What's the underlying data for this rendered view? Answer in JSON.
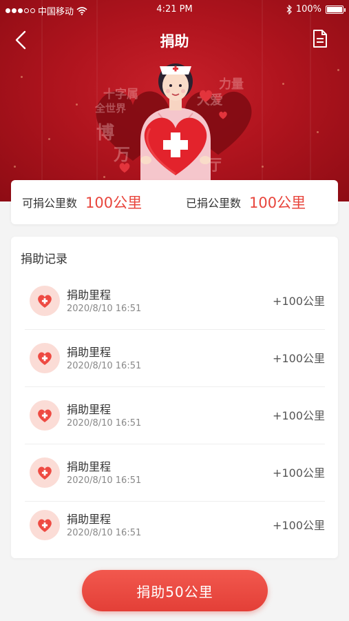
{
  "status_bar": {
    "carrier": "中国移动",
    "time": "4:21 PM",
    "battery": "100%"
  },
  "nav": {
    "title": "捐助",
    "back_icon": "back-arrow-icon",
    "document_icon": "document-icon"
  },
  "hero": {
    "background_text": [
      "十字属",
      "大爱",
      "力量",
      "全世界",
      "博",
      "万",
      "厅"
    ]
  },
  "stats": {
    "available_label": "可捐公里数",
    "available_value": "100公里",
    "donated_label": "已捐公里数",
    "donated_value": "100公里"
  },
  "records": {
    "title": "捐助记录",
    "items": [
      {
        "title": "捐助里程",
        "time": "2020/8/10 16:51",
        "amount": "+100公里"
      },
      {
        "title": "捐助里程",
        "time": "2020/8/10 16:51",
        "amount": "+100公里"
      },
      {
        "title": "捐助里程",
        "time": "2020/8/10 16:51",
        "amount": "+100公里"
      },
      {
        "title": "捐助里程",
        "time": "2020/8/10 16:51",
        "amount": "+100公里"
      },
      {
        "title": "捐助里程",
        "time": "2020/8/10 16:51",
        "amount": "+100公里"
      }
    ]
  },
  "donate_button": {
    "label": "捐助50公里"
  },
  "colors": {
    "accent": "#e8453c",
    "hero_red": "#b0141e",
    "icon_bg": "#fbdcd6"
  }
}
